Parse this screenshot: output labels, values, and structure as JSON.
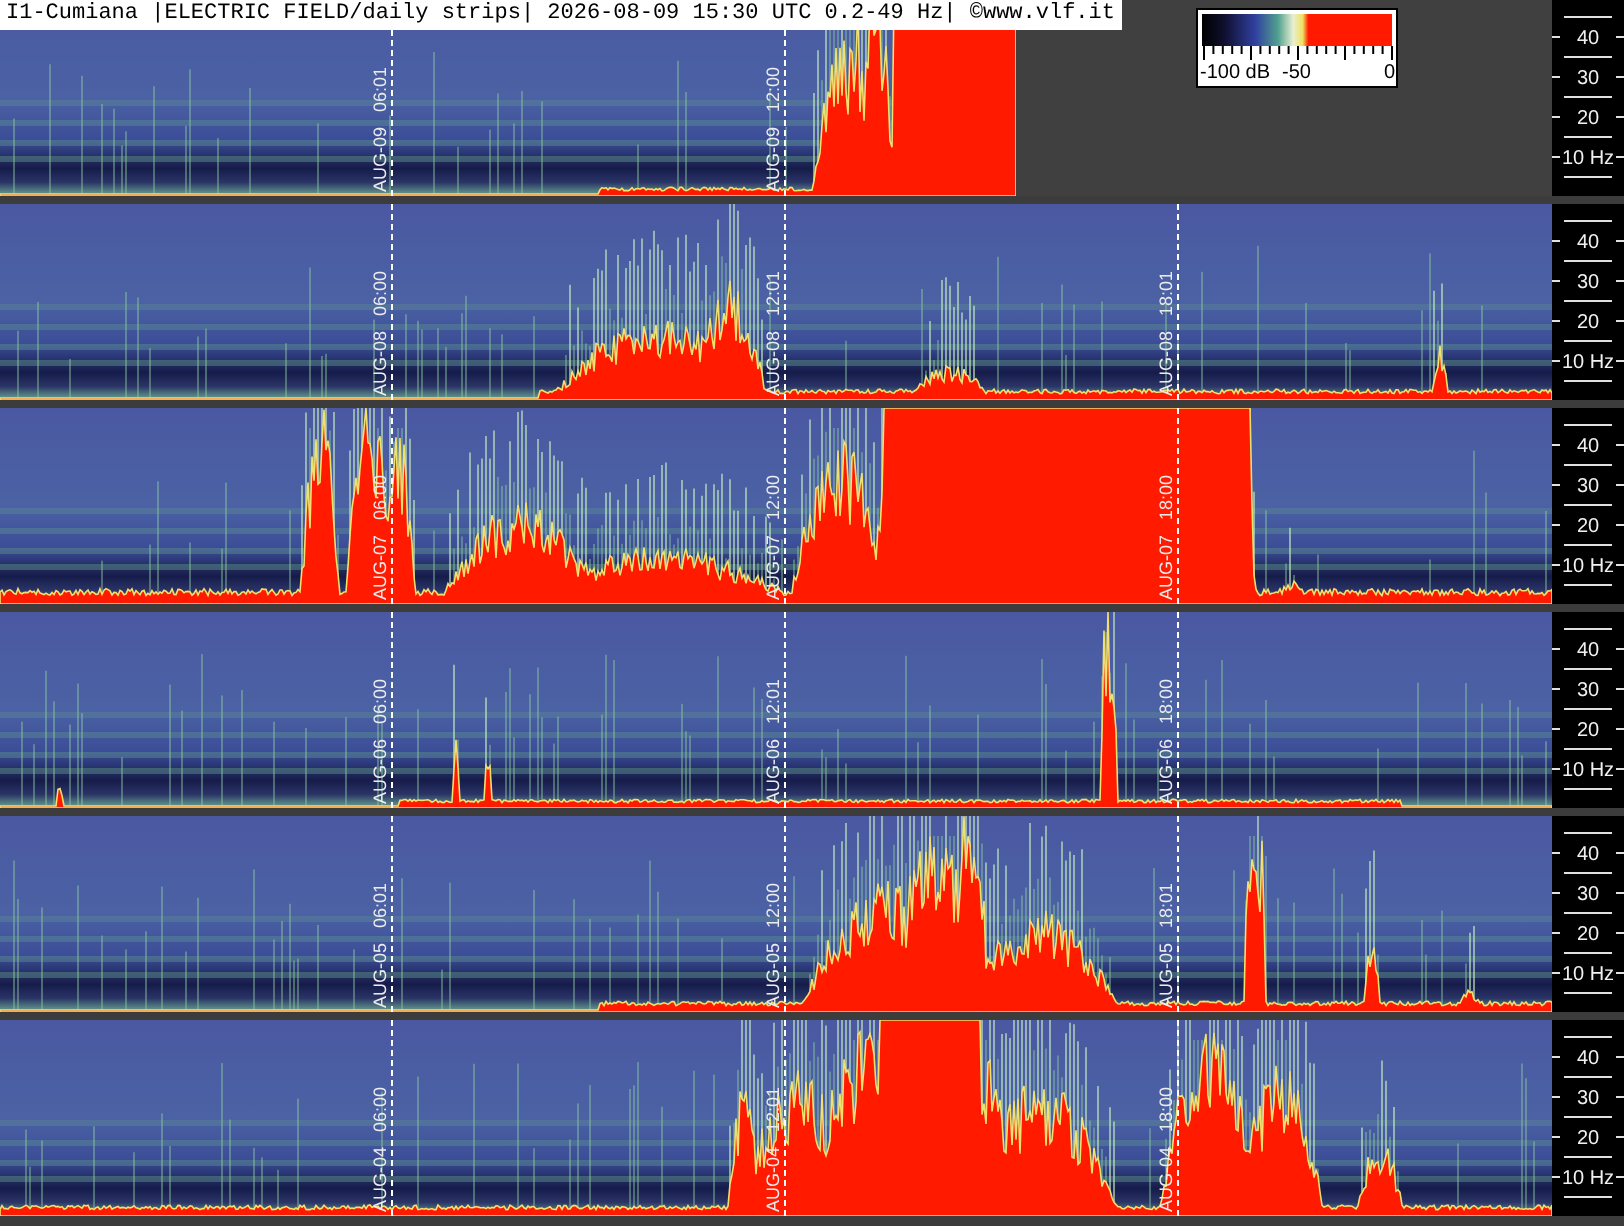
{
  "title": "I1-Cumiana |ELECTRIC FIELD/daily strips| 2026-08-09 15:30 UTC 0.2-49 Hz| ©www.vlf.it",
  "legend": {
    "labels": [
      "-100 dB",
      "-50",
      "0"
    ]
  },
  "strips": [
    {
      "markers": [
        {
          "date": "AUG-09",
          "time": "06:01"
        },
        {
          "date": "AUG-09",
          "time": "12:00"
        }
      ],
      "axis_labels": [
        "40",
        "30",
        "20",
        "10 Hz"
      ]
    },
    {
      "markers": [
        {
          "date": "AUG-08",
          "time": "06:00"
        },
        {
          "date": "AUG-08",
          "time": "12:01"
        },
        {
          "date": "AUG-08",
          "time": "18:01"
        }
      ],
      "axis_labels": [
        "40",
        "30",
        "20",
        "10 Hz"
      ]
    },
    {
      "markers": [
        {
          "date": "AUG-07",
          "time": "06:00"
        },
        {
          "date": "AUG-07",
          "time": "12:00"
        },
        {
          "date": "AUG-07",
          "time": "18:00"
        }
      ],
      "axis_labels": [
        "40",
        "30",
        "20",
        "10 Hz"
      ]
    },
    {
      "markers": [
        {
          "date": "AUG-06",
          "time": "06:00"
        },
        {
          "date": "AUG-06",
          "time": "12:01"
        },
        {
          "date": "AUG-06",
          "time": "18:00"
        }
      ],
      "axis_labels": [
        "40",
        "30",
        "20",
        "10 Hz"
      ]
    },
    {
      "markers": [
        {
          "date": "AUG-05",
          "time": "06:01"
        },
        {
          "date": "AUG-05",
          "time": "12:00"
        },
        {
          "date": "AUG-05",
          "time": "18:01"
        }
      ],
      "axis_labels": [
        "40",
        "30",
        "20",
        "10 Hz"
      ]
    },
    {
      "markers": [
        {
          "date": "AUG-04",
          "time": "06:00"
        },
        {
          "date": "AUG-04",
          "time": "12:01"
        },
        {
          "date": "AUG-04",
          "time": "18:00"
        }
      ],
      "axis_labels": [
        "40",
        "30",
        "20",
        "10 Hz"
      ]
    }
  ]
}
